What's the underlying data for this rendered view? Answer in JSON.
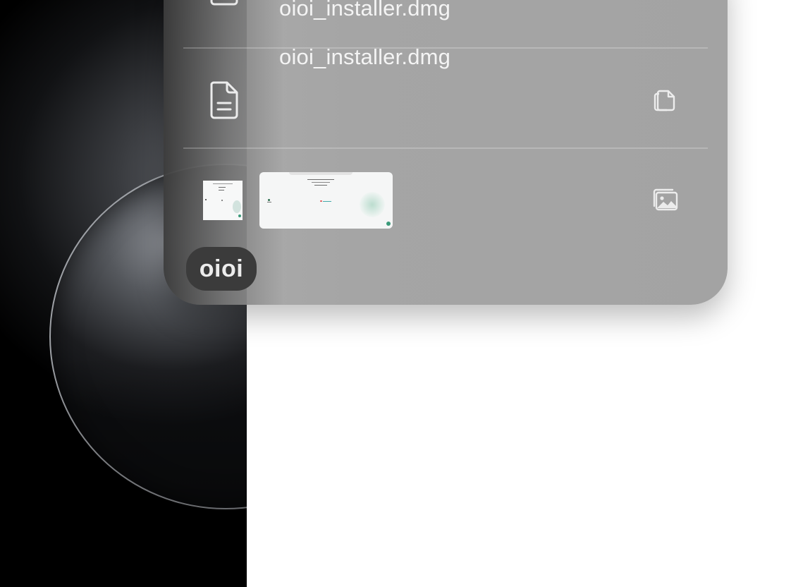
{
  "clipboard": {
    "items": [
      {
        "type": "file",
        "name": "oioi_installer.dmg",
        "icon": "document-icon"
      },
      {
        "type": "file",
        "name": "oioi_installer.dmg",
        "icon": "document-icon",
        "action_icon": "copy-files-icon"
      },
      {
        "type": "image",
        "icon": "image-thumbnail",
        "action_icon": "photos-icon"
      }
    ],
    "app_badge": "oioi"
  },
  "colors": {
    "panel_gray": "#a5a5a5",
    "text_light": "#f4f4f4",
    "badge_bg": "#3b3b3b"
  }
}
